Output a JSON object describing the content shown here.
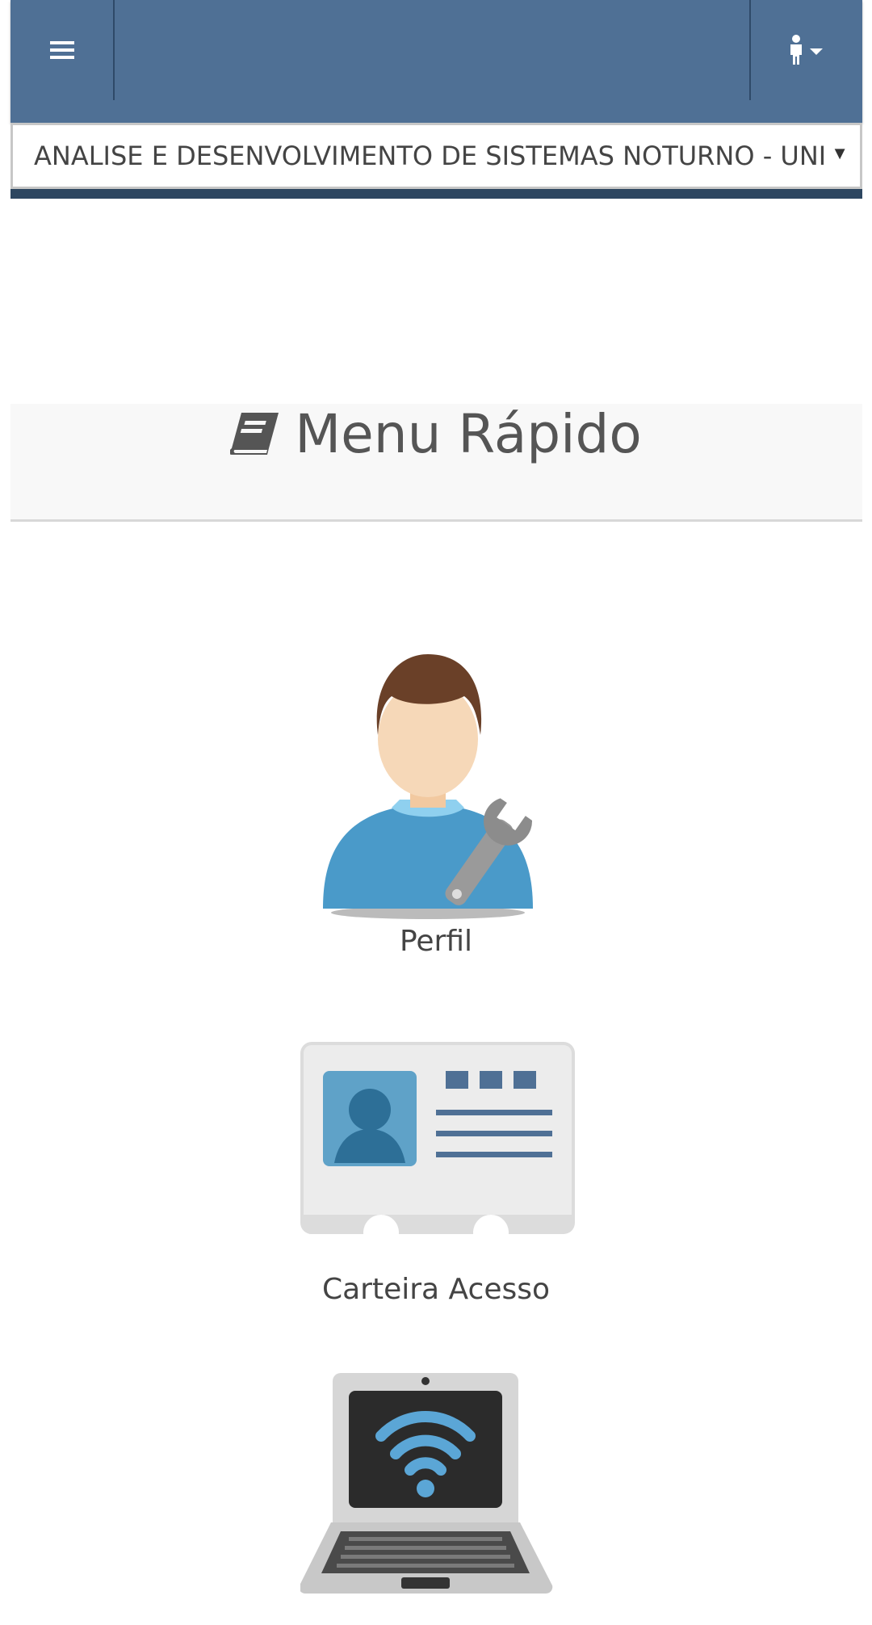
{
  "navbar": {
    "menu_icon": "hamburger-menu-icon",
    "user_icon": "user-dropdown-icon",
    "colors": {
      "bar": "#4f7095",
      "divider": "#2f4a69",
      "strip": "#2d4660"
    }
  },
  "course_select": {
    "selected": "ANALISE E DESENVOLVIMENTO DE SISTEMAS NOTURNO - UNI",
    "arrow": "▼"
  },
  "quick_menu": {
    "title": "Menu Rápido",
    "title_icon": "book-icon",
    "items": [
      {
        "label": "Perfil",
        "icon": "user-profile-wrench-icon"
      },
      {
        "label": "Carteira Acesso",
        "icon": "id-card-icon"
      },
      {
        "label": "",
        "icon": "laptop-wifi-icon"
      }
    ]
  }
}
